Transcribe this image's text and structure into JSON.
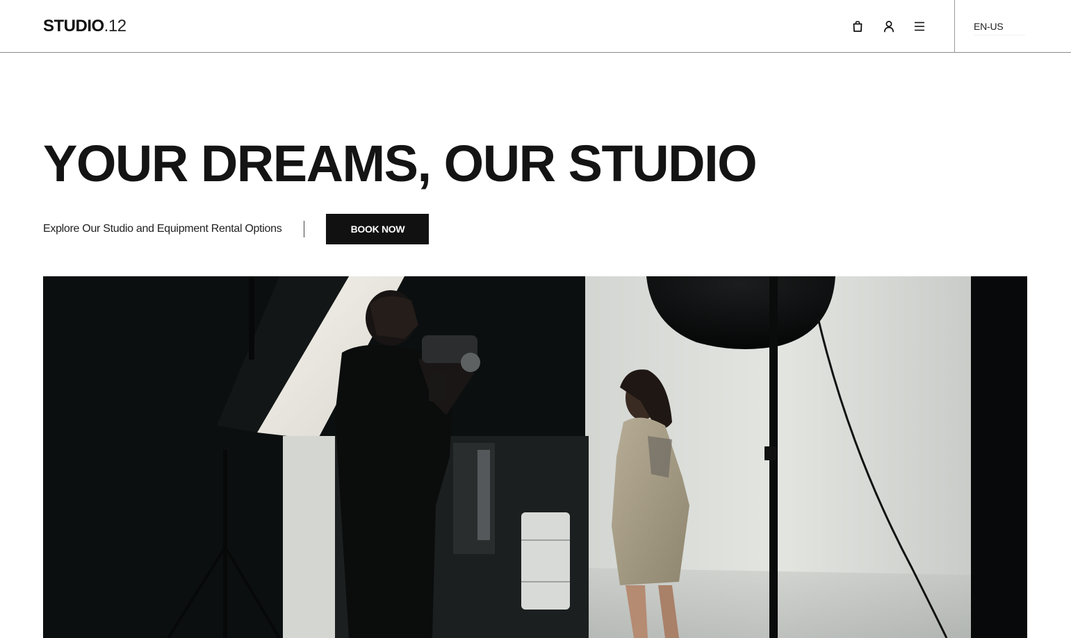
{
  "header": {
    "logo_bold": "STUDIO",
    "logo_light": ".12",
    "icons": [
      "shopping-bag-icon",
      "user-icon",
      "menu-icon"
    ],
    "language": "EN-US"
  },
  "hero": {
    "title": "YOUR DREAMS, OUR STUDIO",
    "subtitle": "Explore Our Studio and Equipment Rental Options",
    "cta_label": "BOOK NOW"
  },
  "colors": {
    "background": "#ffffff",
    "text": "#111111",
    "button_bg": "#111111",
    "button_text": "#ffffff"
  }
}
